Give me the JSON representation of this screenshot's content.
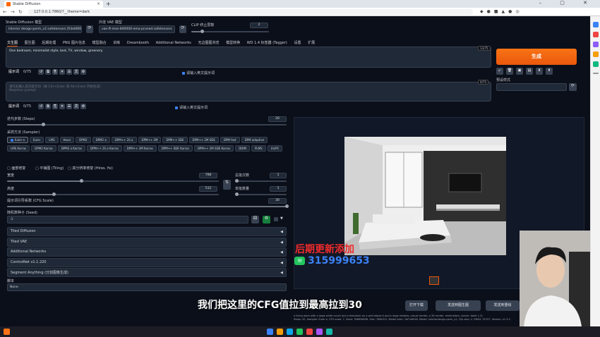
{
  "browser": {
    "tab_title": "Stable Diffusion",
    "url": "127.0.0.1:7860/?__theme=dark",
    "new_tab": "+",
    "win_controls": "–  ▢  ✕"
  },
  "models": {
    "ckpt_label": "Stable Diffusion 模型",
    "ckpt_value": "Interior design-perm_v2.safetensors [fcbd066]",
    "vae_label": "外挂 VAE 模型",
    "vae_value": "vae-ft-mse-840000-ema-pruned.safetensors",
    "clip_label": "CLIP 终止层数",
    "clip_value": "2"
  },
  "tabs": [
    "文生图",
    "图生图",
    "后期处理",
    "PNG 图片信息",
    "模型融合",
    "训练",
    "Dreambooth",
    "Additional Networks",
    "无边图图浏览",
    "模型转换",
    "WD 1.4 标签器 (Tagger)",
    "设置",
    "扩展"
  ],
  "prompt": {
    "text": "One bedroom, minimalist style, bed, TV, window, greenery",
    "count": "13/75",
    "neg_placeholder": "请在此输入反向提示词（按 Ctrl+Enter 或 Alt+Enter 开始生成）\nNegative prompt",
    "neg_count": "0/75",
    "token_label": "提示词",
    "bytes": "0/75",
    "token_check": "请输入英文提示词"
  },
  "generate": {
    "label": "生成",
    "style_label": "预设样式"
  },
  "sampling": {
    "steps_label": "迭代步数 (Steps)",
    "steps": "20",
    "sampler_label": "采样方法 (Sampler)",
    "methods": [
      "Euler a",
      "Euler",
      "LMS",
      "Heun",
      "DPM2",
      "DPM2 a",
      "DPM++ 2S a",
      "DPM++ 2M",
      "DPM++ SDE",
      "DPM++ 2M SDE",
      "DPM fast",
      "DPM adaptive",
      "LMS Karras",
      "DPM2 Karras",
      "DPM2 a Karras",
      "DPM++ 2S a Karras",
      "DPM++ 2M Karras",
      "DPM++ SDE Karras",
      "DPM++ 2M SDE Karras",
      "DDIM",
      "PLMS",
      "UniPC"
    ],
    "steps_frac": 0.13
  },
  "options": {
    "restore": "面部修复",
    "tiling": "平铺图 (Tiling)",
    "hires": "高分辨率修复 (Hires. fix)"
  },
  "size": {
    "width_label": "宽度",
    "width": "768",
    "height_label": "高度",
    "height": "512",
    "batch_count_label": "总批次数",
    "batch_count": "1",
    "batch_size_label": "单批数量",
    "batch_size": "1",
    "width_frac": 0.35,
    "height_frac": 0.22
  },
  "cfg": {
    "label": "提示词引导系数 (CFG Scale)",
    "value": "30",
    "frac": 1.0
  },
  "seed": {
    "label": "随机数种子 (Seed)",
    "value": "-1"
  },
  "accordions": [
    "Tiled Diffusion",
    "Tiled VAE",
    "Additional Networks",
    "ControlNet v1.1.220",
    "Segment Anything (分割图像生成)"
  ],
  "script": {
    "label": "脚本",
    "value": "None"
  },
  "output": {
    "buttons": [
      "打开下载",
      "发送到图生图",
      "发送到重绘"
    ],
    "info": "a living room with a large white couch and a television on a wall above it and a large window, casual render, a 3D render, minimalism, (brush: table 1.3)\nSteps: 20, Sampler: Euler a, CFG scale: 7, Seed: 786656836, Size: 768x512, Model hash: 7bf7e6946, Model: interiordesign-perm_v2, Clip skip: 2, ENSD: 31337, Version: v1.3.2"
  },
  "overlay": {
    "promo_title": "后期更新添加",
    "promo_wechat": "315999653",
    "subtitle": "我们把这里的CFG值拉到最高拉到30"
  },
  "colors": {
    "accent": "#ea580c",
    "bg": "#0b0f19"
  }
}
